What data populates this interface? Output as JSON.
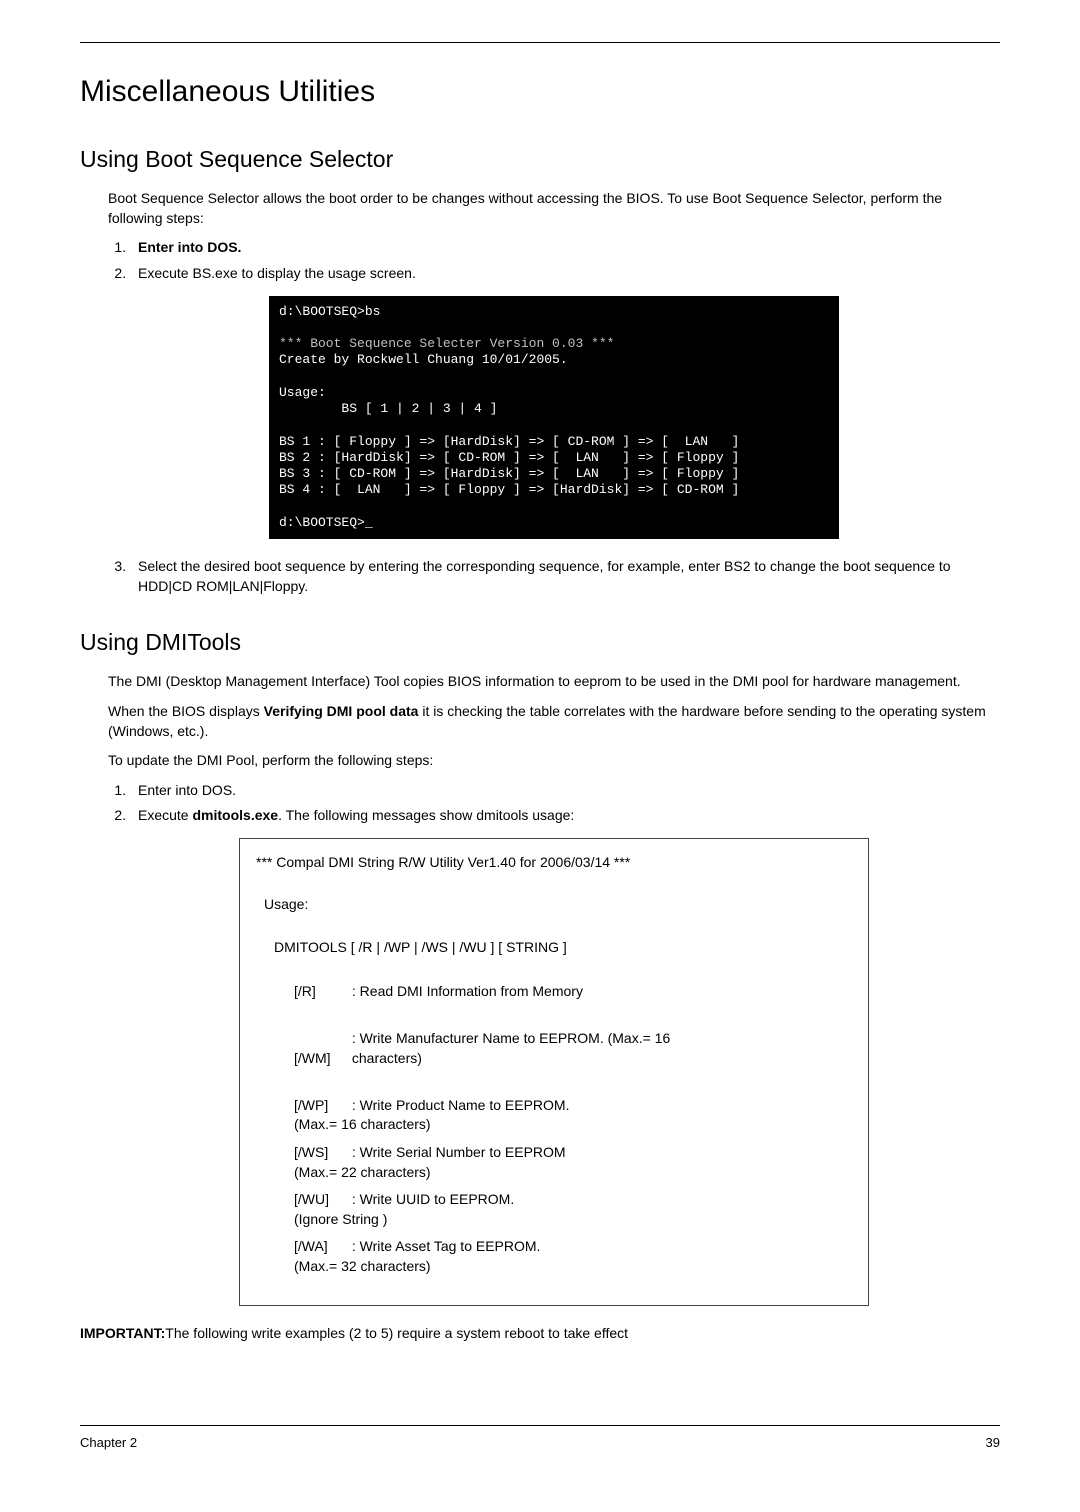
{
  "h1": "Miscellaneous Utilities",
  "boot_selector": {
    "title": "Using Boot Sequence Selector",
    "intro": "Boot Sequence Selector allows the boot order to be changes without accessing the BIOS. To use Boot Sequence Selector, perform the following steps:",
    "steps": [
      "Enter into DOS.",
      "Execute BS.exe to display the usage screen."
    ],
    "code_lines": {
      "l1": "d:\\BOOTSEQ>bs",
      "l2": "*** Boot Sequence Selecter Version 0.03 ***",
      "l3": "Create by Rockwell Chuang 10/01/2005.",
      "l4": "Usage:",
      "l5": "        BS [ 1 | 2 | 3 | 4 ]",
      "l6": "BS 1 : [ Floppy ] => [HardDisk] => [ CD-ROM ] => [  LAN   ]",
      "l7": "BS 2 : [HardDisk] => [ CD-ROM ] => [  LAN   ] => [ Floppy ]",
      "l8": "BS 3 : [ CD-ROM ] => [HardDisk] => [  LAN   ] => [ Floppy ]",
      "l9": "BS 4 : [  LAN   ] => [ Floppy ] => [HardDisk] => [ CD-ROM ]",
      "l10": "d:\\BOOTSEQ>"
    },
    "step3": "Select the desired boot sequence by entering the corresponding sequence, for example, enter BS2 to change the boot sequence to HDD|CD ROM|LAN|Floppy."
  },
  "dmitools": {
    "title": "Using DMITools",
    "p1": "The DMI (Desktop Management Interface) Tool copies BIOS information to eeprom to be used in the DMI pool for hardware management.",
    "p2a": "When the BIOS displays ",
    "p2b": "Verifying DMI pool data",
    "p2c": " it is checking the table correlates with the hardware before sending to the operating system (Windows, etc.).",
    "p3": "To update the DMI Pool, perform the following steps:",
    "steps": {
      "s1": "Enter into DOS.",
      "s2a": "Execute ",
      "s2b": "dmitools.exe",
      "s2c": ". The following messages show dmitools usage:"
    },
    "usage_box": {
      "title": "*** Compal DMI String R/W Utility Ver1.40 for 2006/03/14 ***",
      "usage_label": "Usage:",
      "cmd": "DMITOOLS [ /R | /WP | /WS | /WU ] [ STRING ]",
      "rows": [
        {
          "flag": "[/R]",
          "desc": ": Read DMI Information from Memory",
          "max": ""
        },
        {
          "flag": "[/WM]",
          "desc": ": Write Manufacturer Name to EEPROM. (Max.= 16 characters)",
          "max": ""
        },
        {
          "flag": "[/WP]",
          "desc": ": Write Product Name to EEPROM.",
          "max": "(Max.= 16 characters)"
        },
        {
          "flag": "[/WS]",
          "desc": ": Write Serial Number to EEPROM",
          "max": "(Max.= 22 characters)"
        },
        {
          "flag": "[/WU]",
          "desc": ": Write UUID to EEPROM.",
          "max": "(Ignore String           )"
        },
        {
          "flag": "[/WA]",
          "desc": ": Write Asset Tag to EEPROM.",
          "max": "(Max.= 32 characters)"
        }
      ]
    },
    "important_label": "IMPORTANT:",
    "important_text": "The following write examples (2 to 5) require a system reboot to take effect"
  },
  "footer": {
    "left": "Chapter 2",
    "right": "39"
  }
}
